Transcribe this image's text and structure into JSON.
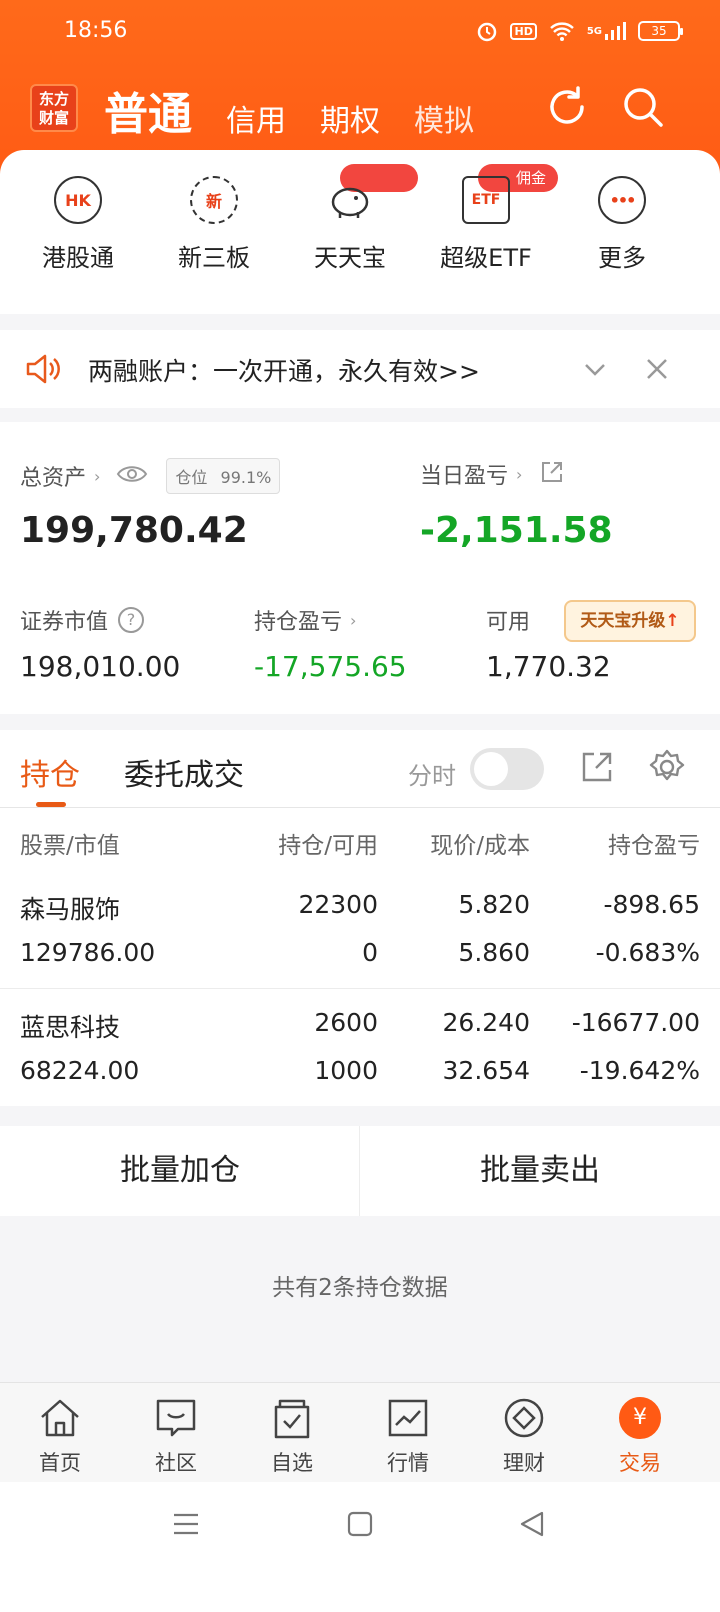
{
  "status": {
    "time": "18:56",
    "hd": "HD",
    "signal": "5G",
    "battery": "35"
  },
  "header": {
    "logo": "东方\n财富",
    "tabs": [
      "普通",
      "信用",
      "期权",
      "模拟"
    ],
    "refresh_icon": "refresh-icon",
    "search_icon": "search-icon"
  },
  "quick": {
    "items": [
      {
        "icon_text": "HK",
        "label": "港股通"
      },
      {
        "icon_text": "新",
        "label": "新三板"
      },
      {
        "icon_text": "",
        "label": "天天宝"
      },
      {
        "icon_text": "ETF",
        "label": "超级ETF"
      },
      {
        "icon_text": "•••",
        "label": "更多"
      }
    ],
    "badge_etf": "佣金"
  },
  "notice": {
    "text": "两融账户：一次开通，永久有效>>"
  },
  "assets": {
    "total_label": "总资产",
    "position_chip_label": "仓位",
    "position_chip_value": "99.1%",
    "total_value": "199,780.42",
    "daily_label": "当日盈亏",
    "daily_value": "-2,151.58",
    "market_label": "证券市值",
    "market_value": "198,010.00",
    "holding_pl_label": "持仓盈亏",
    "holding_pl_value": "-17,575.65",
    "available_label": "可用",
    "available_value": "1,770.32",
    "upgrade_label": "天天宝升级"
  },
  "positions": {
    "tab_active": "持仓",
    "tab_other": "委托成交",
    "fenshi": "分时",
    "columns": [
      "股票/市值",
      "持仓/可用",
      "现价/成本",
      "持仓盈亏"
    ],
    "rows": [
      {
        "name": "森马服饰",
        "market_value": "129786.00",
        "hold": "22300",
        "avail": "0",
        "price": "5.820",
        "cost": "5.860",
        "pl": "-898.65",
        "pl_pct": "-0.683%"
      },
      {
        "name": "蓝思科技",
        "market_value": "68224.00",
        "hold": "2600",
        "avail": "1000",
        "price": "26.240",
        "cost": "32.654",
        "pl": "-16677.00",
        "pl_pct": "-19.642%"
      }
    ]
  },
  "batch": {
    "add": "批量加仓",
    "sell": "批量卖出"
  },
  "summary": "共有2条持仓数据",
  "bottom_nav": [
    {
      "label": "首页"
    },
    {
      "label": "社区"
    },
    {
      "label": "自选"
    },
    {
      "label": "行情"
    },
    {
      "label": "理财"
    },
    {
      "label": "交易",
      "icon_text": "¥"
    }
  ],
  "colors": {
    "brand": "#ff5a14",
    "loss": "#14a626",
    "active": "#e85a16"
  }
}
